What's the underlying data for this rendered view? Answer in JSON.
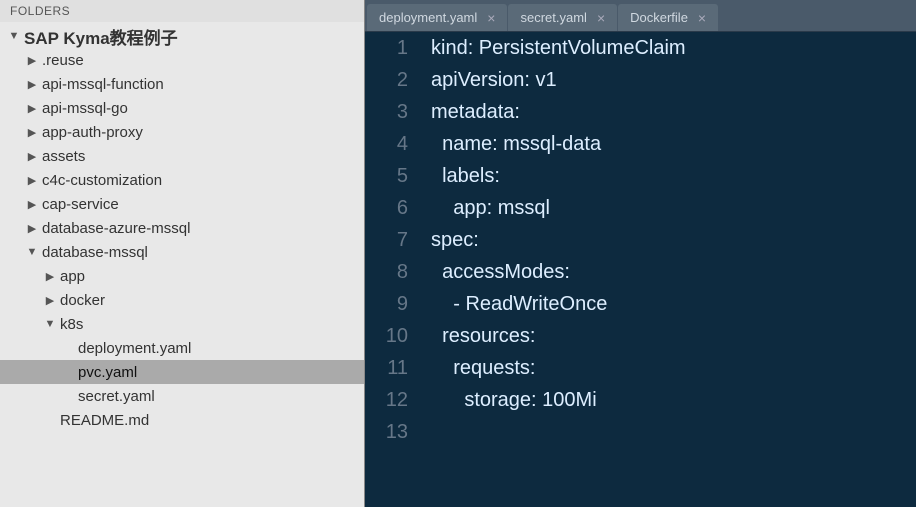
{
  "sidebar": {
    "header": "FOLDERS",
    "root": "SAP Kyma教程例子",
    "items": [
      {
        "label": ".reuse",
        "depth": 1,
        "arrow": "right"
      },
      {
        "label": "api-mssql-function",
        "depth": 1,
        "arrow": "right"
      },
      {
        "label": "api-mssql-go",
        "depth": 1,
        "arrow": "right"
      },
      {
        "label": "app-auth-proxy",
        "depth": 1,
        "arrow": "right"
      },
      {
        "label": "assets",
        "depth": 1,
        "arrow": "right"
      },
      {
        "label": "c4c-customization",
        "depth": 1,
        "arrow": "right"
      },
      {
        "label": "cap-service",
        "depth": 1,
        "arrow": "right"
      },
      {
        "label": "database-azure-mssql",
        "depth": 1,
        "arrow": "right"
      },
      {
        "label": "database-mssql",
        "depth": 1,
        "arrow": "down"
      },
      {
        "label": "app",
        "depth": 2,
        "arrow": "right"
      },
      {
        "label": "docker",
        "depth": 2,
        "arrow": "right"
      },
      {
        "label": "k8s",
        "depth": 2,
        "arrow": "down"
      },
      {
        "label": "deployment.yaml",
        "depth": 3,
        "arrow": "none"
      },
      {
        "label": "pvc.yaml",
        "depth": 3,
        "arrow": "none",
        "selected": true
      },
      {
        "label": "secret.yaml",
        "depth": 3,
        "arrow": "none"
      },
      {
        "label": "README.md",
        "depth": 2,
        "arrow": "none"
      }
    ]
  },
  "tabs": [
    {
      "label": "deployment.yaml"
    },
    {
      "label": "secret.yaml"
    },
    {
      "label": "Dockerfile"
    }
  ],
  "code": {
    "lines": [
      "kind: PersistentVolumeClaim",
      "apiVersion: v1",
      "metadata:",
      "  name: mssql-data",
      "  labels:",
      "    app: mssql",
      "spec:",
      "  accessModes:",
      "    - ReadWriteOnce",
      "  resources:",
      "    requests:",
      "      storage: 100Mi",
      ""
    ]
  }
}
